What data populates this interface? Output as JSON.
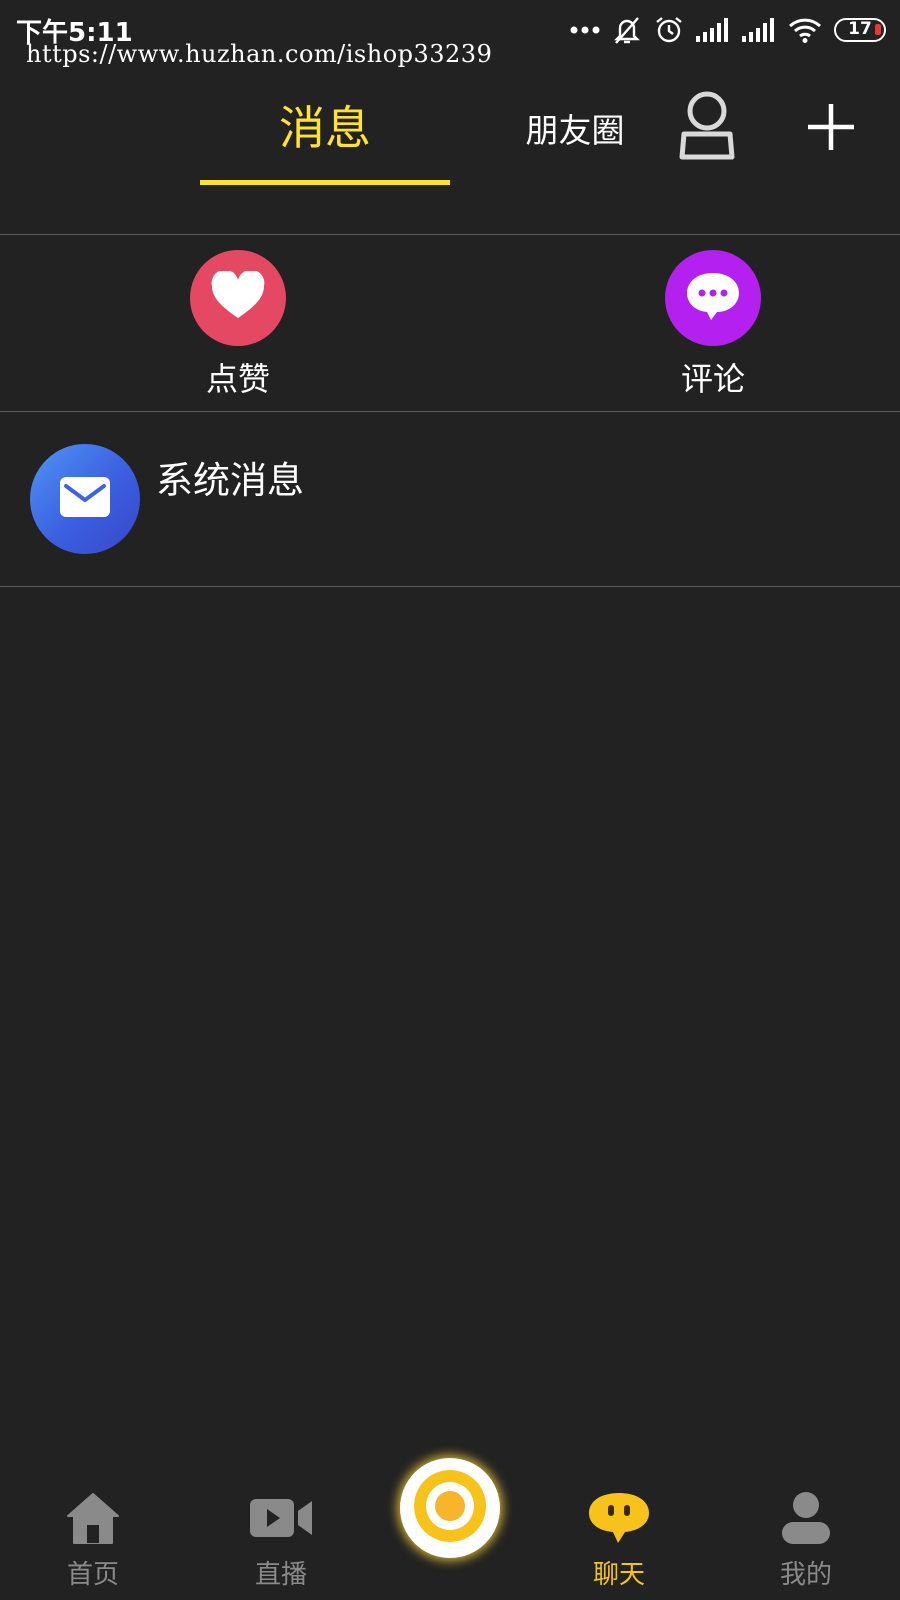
{
  "status_bar": {
    "time": "下午5:11",
    "watermark": "https://www.huzhan.com/ishop33239",
    "battery": "17",
    "icons": [
      "more-dots-icon",
      "mute-bell-icon",
      "alarm-icon",
      "signal-icon",
      "signal-icon",
      "wifi-icon",
      "battery-icon"
    ]
  },
  "header": {
    "tabs": [
      {
        "label": "消息",
        "active": true
      },
      {
        "label": "朋友圈",
        "active": false
      }
    ],
    "user_icon": "user-outline-icon",
    "add_icon": "plus-icon",
    "accent_color": "#ffe234"
  },
  "quick_actions": [
    {
      "label": "点赞",
      "icon": "heart-icon",
      "color": "#e54862"
    },
    {
      "label": "评论",
      "icon": "comment-icon",
      "color": "#b320f0"
    }
  ],
  "messages": [
    {
      "title": "系统消息",
      "icon": "envelope-icon"
    }
  ],
  "bottom_nav": {
    "items": [
      {
        "label": "首页",
        "icon": "home-icon",
        "active": false
      },
      {
        "label": "直播",
        "icon": "video-camera-icon",
        "active": false
      },
      {
        "label": "",
        "icon": "record-button-icon",
        "active": false
      },
      {
        "label": "聊天",
        "icon": "chat-bubble-icon",
        "active": true
      },
      {
        "label": "我的",
        "icon": "profile-icon",
        "active": false
      }
    ],
    "active_color": "#f8c21d",
    "inactive_color": "#8a8a8a"
  }
}
